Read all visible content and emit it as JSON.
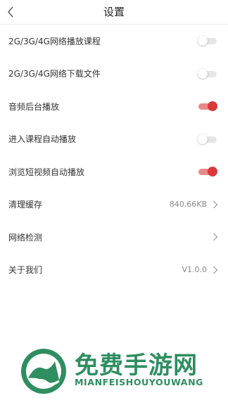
{
  "header": {
    "title": "设置",
    "back_icon": "chevron-left-icon"
  },
  "settings": [
    {
      "label": "2G/3G/4G网络播放课程",
      "type": "toggle",
      "on": false
    },
    {
      "label": "2G/3G/4G网络下载文件",
      "type": "toggle",
      "on": false
    },
    {
      "label": "音频后台播放",
      "type": "toggle",
      "on": true
    },
    {
      "label": "进入课程自动播放",
      "type": "toggle",
      "on": false
    },
    {
      "label": "浏览短视频自动播放",
      "type": "toggle",
      "on": true
    },
    {
      "label": "清理缓存",
      "type": "link",
      "value": "840.66KB"
    },
    {
      "label": "网络检测",
      "type": "link",
      "value": ""
    },
    {
      "label": "关于我们",
      "type": "link",
      "value": "V1.0.0"
    }
  ],
  "watermark": {
    "text_cn": "免费手游网",
    "text_en": "MIANFEISHOUYOUWANG"
  },
  "colors": {
    "accent": "#d9393a",
    "accent_track": "#e88a87",
    "off_track": "#e6e6e6",
    "watermark": "#2e8e60"
  }
}
